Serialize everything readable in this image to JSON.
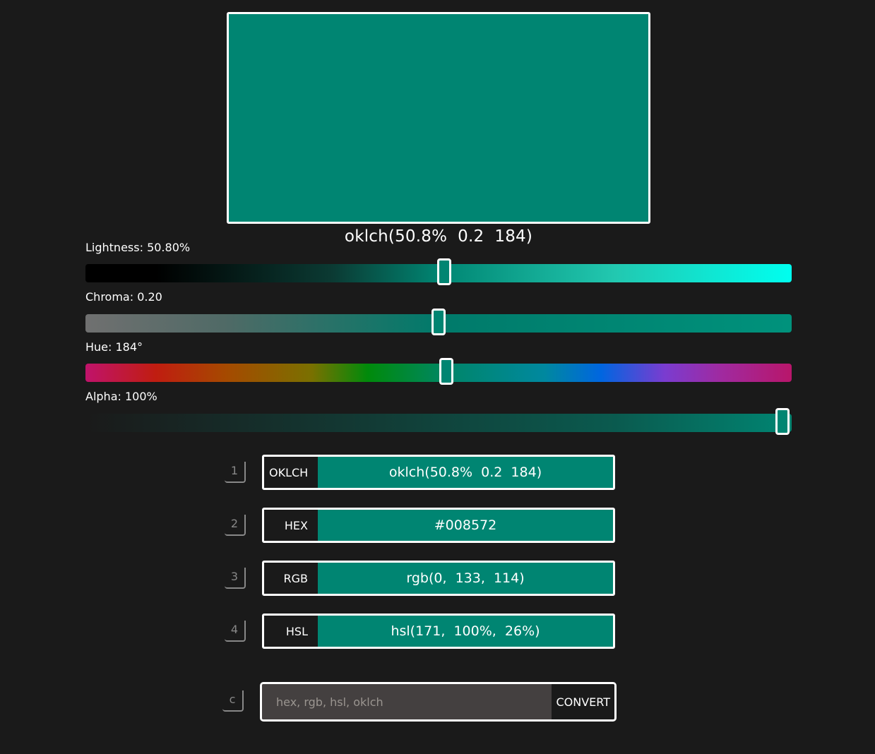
{
  "colors": {
    "background": "#1a1a1a",
    "current": "#008572",
    "border": "#ffffff"
  },
  "preview": {
    "label": "oklch(50.8%  0.2  184)"
  },
  "sliders": {
    "lightness": {
      "label": "Lightness: 50.80%",
      "value_fraction": 0.508
    },
    "chroma": {
      "label": "Chroma: 0.20",
      "value_fraction": 0.5
    },
    "hue": {
      "label": "Hue: 184°",
      "value_fraction": 0.511
    },
    "alpha": {
      "label": "Alpha: 100%",
      "value_fraction": 0.987
    }
  },
  "formats": [
    {
      "key": "1",
      "name": "OKLCH",
      "value": "oklch(50.8%  0.2  184)"
    },
    {
      "key": "2",
      "name": "HEX",
      "value": "#008572"
    },
    {
      "key": "3",
      "name": "RGB",
      "value": "rgb(0,  133,  114)"
    },
    {
      "key": "4",
      "name": "HSL",
      "value": "hsl(171,  100%,  26%)"
    }
  ],
  "convert": {
    "key": "c",
    "placeholder": "hex, rgb, hsl, oklch",
    "value": "",
    "button_label": "CONVERT"
  }
}
